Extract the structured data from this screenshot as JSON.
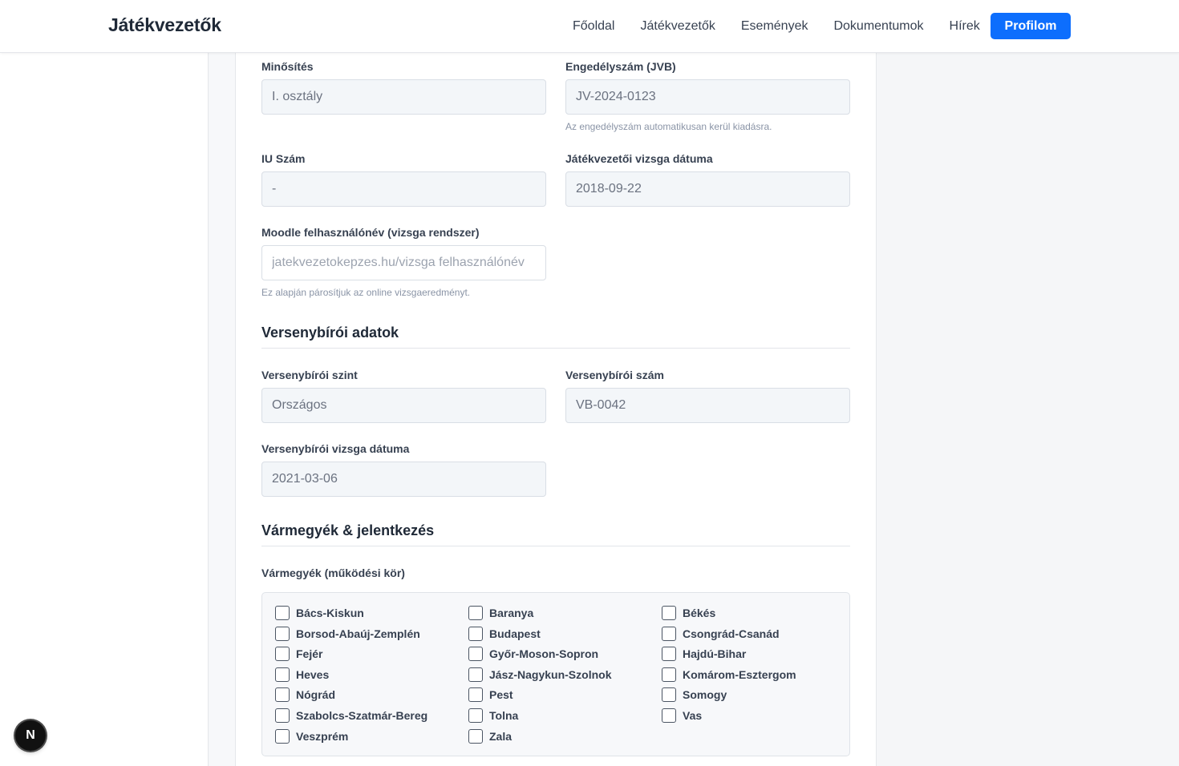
{
  "nav": {
    "brand": "Játékvezetők",
    "links": [
      "Főoldal",
      "Játékvezetők",
      "Események",
      "Dokumentumok",
      "Hírek"
    ],
    "profile_button": "Profilom"
  },
  "jv": {
    "qualification_label": "Minősítés",
    "qualification_value": "I. osztály",
    "license_label": "Engedélyszám (JVB)",
    "license_value": "JV-2024-0123",
    "license_hint": "Az engedélyszám automatikusan kerül kiadásra.",
    "iu_label": "IU Szám",
    "iu_value": "-",
    "exam_date_label": "Játékvezetői vizsga dátuma",
    "exam_date_value": "2018-09-22",
    "moodle_label": "Moodle felhasználónév (vizsga rendszer)",
    "moodle_placeholder": "jatekvezetokepzes.hu/vizsga felhasználónév",
    "moodle_hint": "Ez alapján párosítjuk az online vizsgaeredményt."
  },
  "vb": {
    "section_title": "Versenybírói adatok",
    "level_label": "Versenybírói szint",
    "level_value": "Országos",
    "number_label": "Versenybírói szám",
    "number_value": "VB-0042",
    "exam_date_label": "Versenybírói vizsga dátuma",
    "exam_date_value": "2021-03-06"
  },
  "counties": {
    "section_title": "Vármegyék & jelentkezés",
    "field_label": "Vármegyék (működési kör)",
    "items": [
      "Bács-Kiskun",
      "Baranya",
      "Békés",
      "Borsod-Abaúj-Zemplén",
      "Budapest",
      "Csongrád-Csanád",
      "Fejér",
      "Győr-Moson-Sopron",
      "Hajdú-Bihar",
      "Heves",
      "Jász-Nagykun-Szolnok",
      "Komárom-Esztergom",
      "Nógrád",
      "Pest",
      "Somogy",
      "Szabolcs-Szatmár-Bereg",
      "Tolna",
      "Vas",
      "Veszprém",
      "Zala"
    ]
  },
  "fab": {
    "label": "N"
  }
}
